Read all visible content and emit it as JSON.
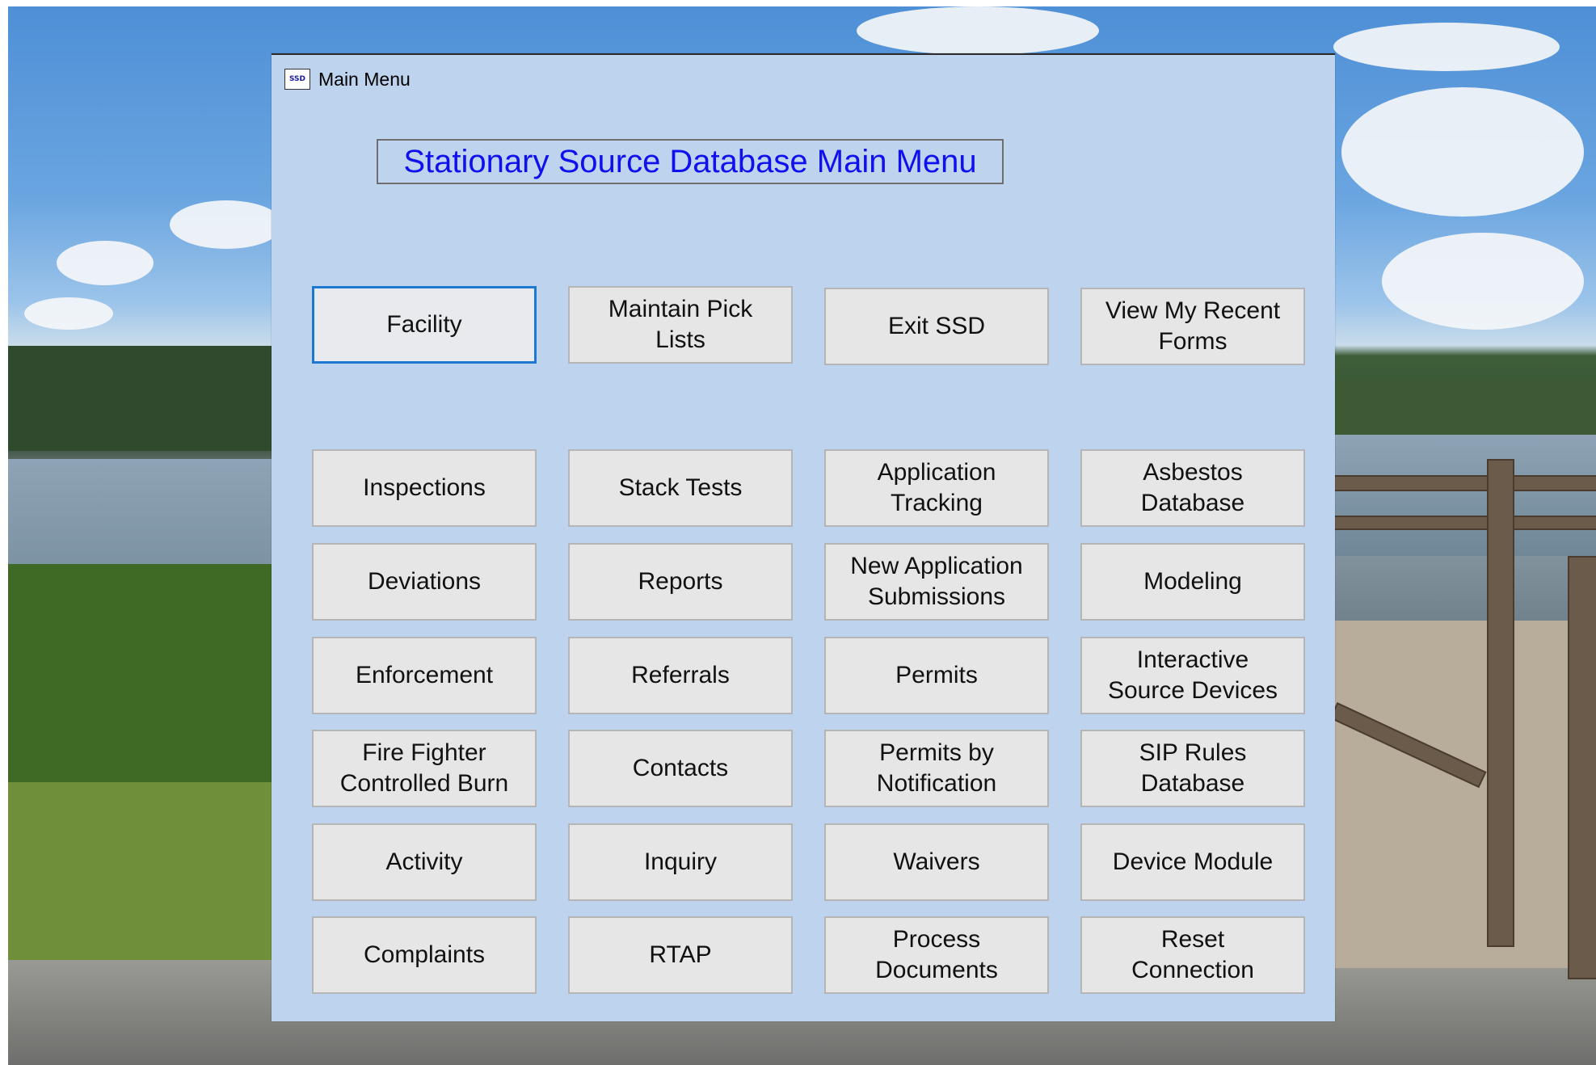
{
  "window": {
    "title": "Main Menu",
    "icon_text": "SSD",
    "icon_name": "ssd-app-icon"
  },
  "heading": "Stationary Source Database Main Menu",
  "colors": {
    "window_background": "#bdd3ee",
    "heading_text": "#1010ee",
    "button_face": "#e6e6e6",
    "focus_border": "#1e78d2"
  },
  "top_row": [
    {
      "id": "facility",
      "label": "Facility",
      "focused": true
    },
    {
      "id": "maintain-pick-lists",
      "label": "Maintain Pick\nLists"
    },
    {
      "id": "exit-ssd",
      "label": "Exit SSD"
    },
    {
      "id": "view-my-recent-forms",
      "label": "View My Recent\nForms"
    }
  ],
  "grid": [
    [
      {
        "id": "inspections",
        "label": "Inspections"
      },
      {
        "id": "stack-tests",
        "label": "Stack Tests"
      },
      {
        "id": "application-tracking",
        "label": "Application\nTracking"
      },
      {
        "id": "asbestos-database",
        "label": "Asbestos\nDatabase"
      }
    ],
    [
      {
        "id": "deviations",
        "label": "Deviations"
      },
      {
        "id": "reports",
        "label": "Reports"
      },
      {
        "id": "new-application-submissions",
        "label": "New Application\nSubmissions"
      },
      {
        "id": "modeling",
        "label": "Modeling"
      }
    ],
    [
      {
        "id": "enforcement",
        "label": "Enforcement"
      },
      {
        "id": "referrals",
        "label": "Referrals"
      },
      {
        "id": "permits",
        "label": "Permits"
      },
      {
        "id": "interactive-source-devices",
        "label": "Interactive\nSource Devices"
      }
    ],
    [
      {
        "id": "fire-fighter-controlled-burn",
        "label": "Fire Fighter\nControlled Burn"
      },
      {
        "id": "contacts",
        "label": "Contacts"
      },
      {
        "id": "permits-by-notification",
        "label": "Permits by\nNotification"
      },
      {
        "id": "sip-rules-database",
        "label": "SIP Rules\nDatabase"
      }
    ],
    [
      {
        "id": "activity",
        "label": "Activity"
      },
      {
        "id": "inquiry",
        "label": "Inquiry"
      },
      {
        "id": "waivers",
        "label": "Waivers"
      },
      {
        "id": "device-module",
        "label": "Device Module"
      }
    ],
    [
      {
        "id": "complaints",
        "label": "Complaints"
      },
      {
        "id": "rtap",
        "label": "RTAP"
      },
      {
        "id": "process-documents",
        "label": "Process\nDocuments"
      },
      {
        "id": "reset-connection",
        "label": "Reset\nConnection"
      }
    ]
  ]
}
